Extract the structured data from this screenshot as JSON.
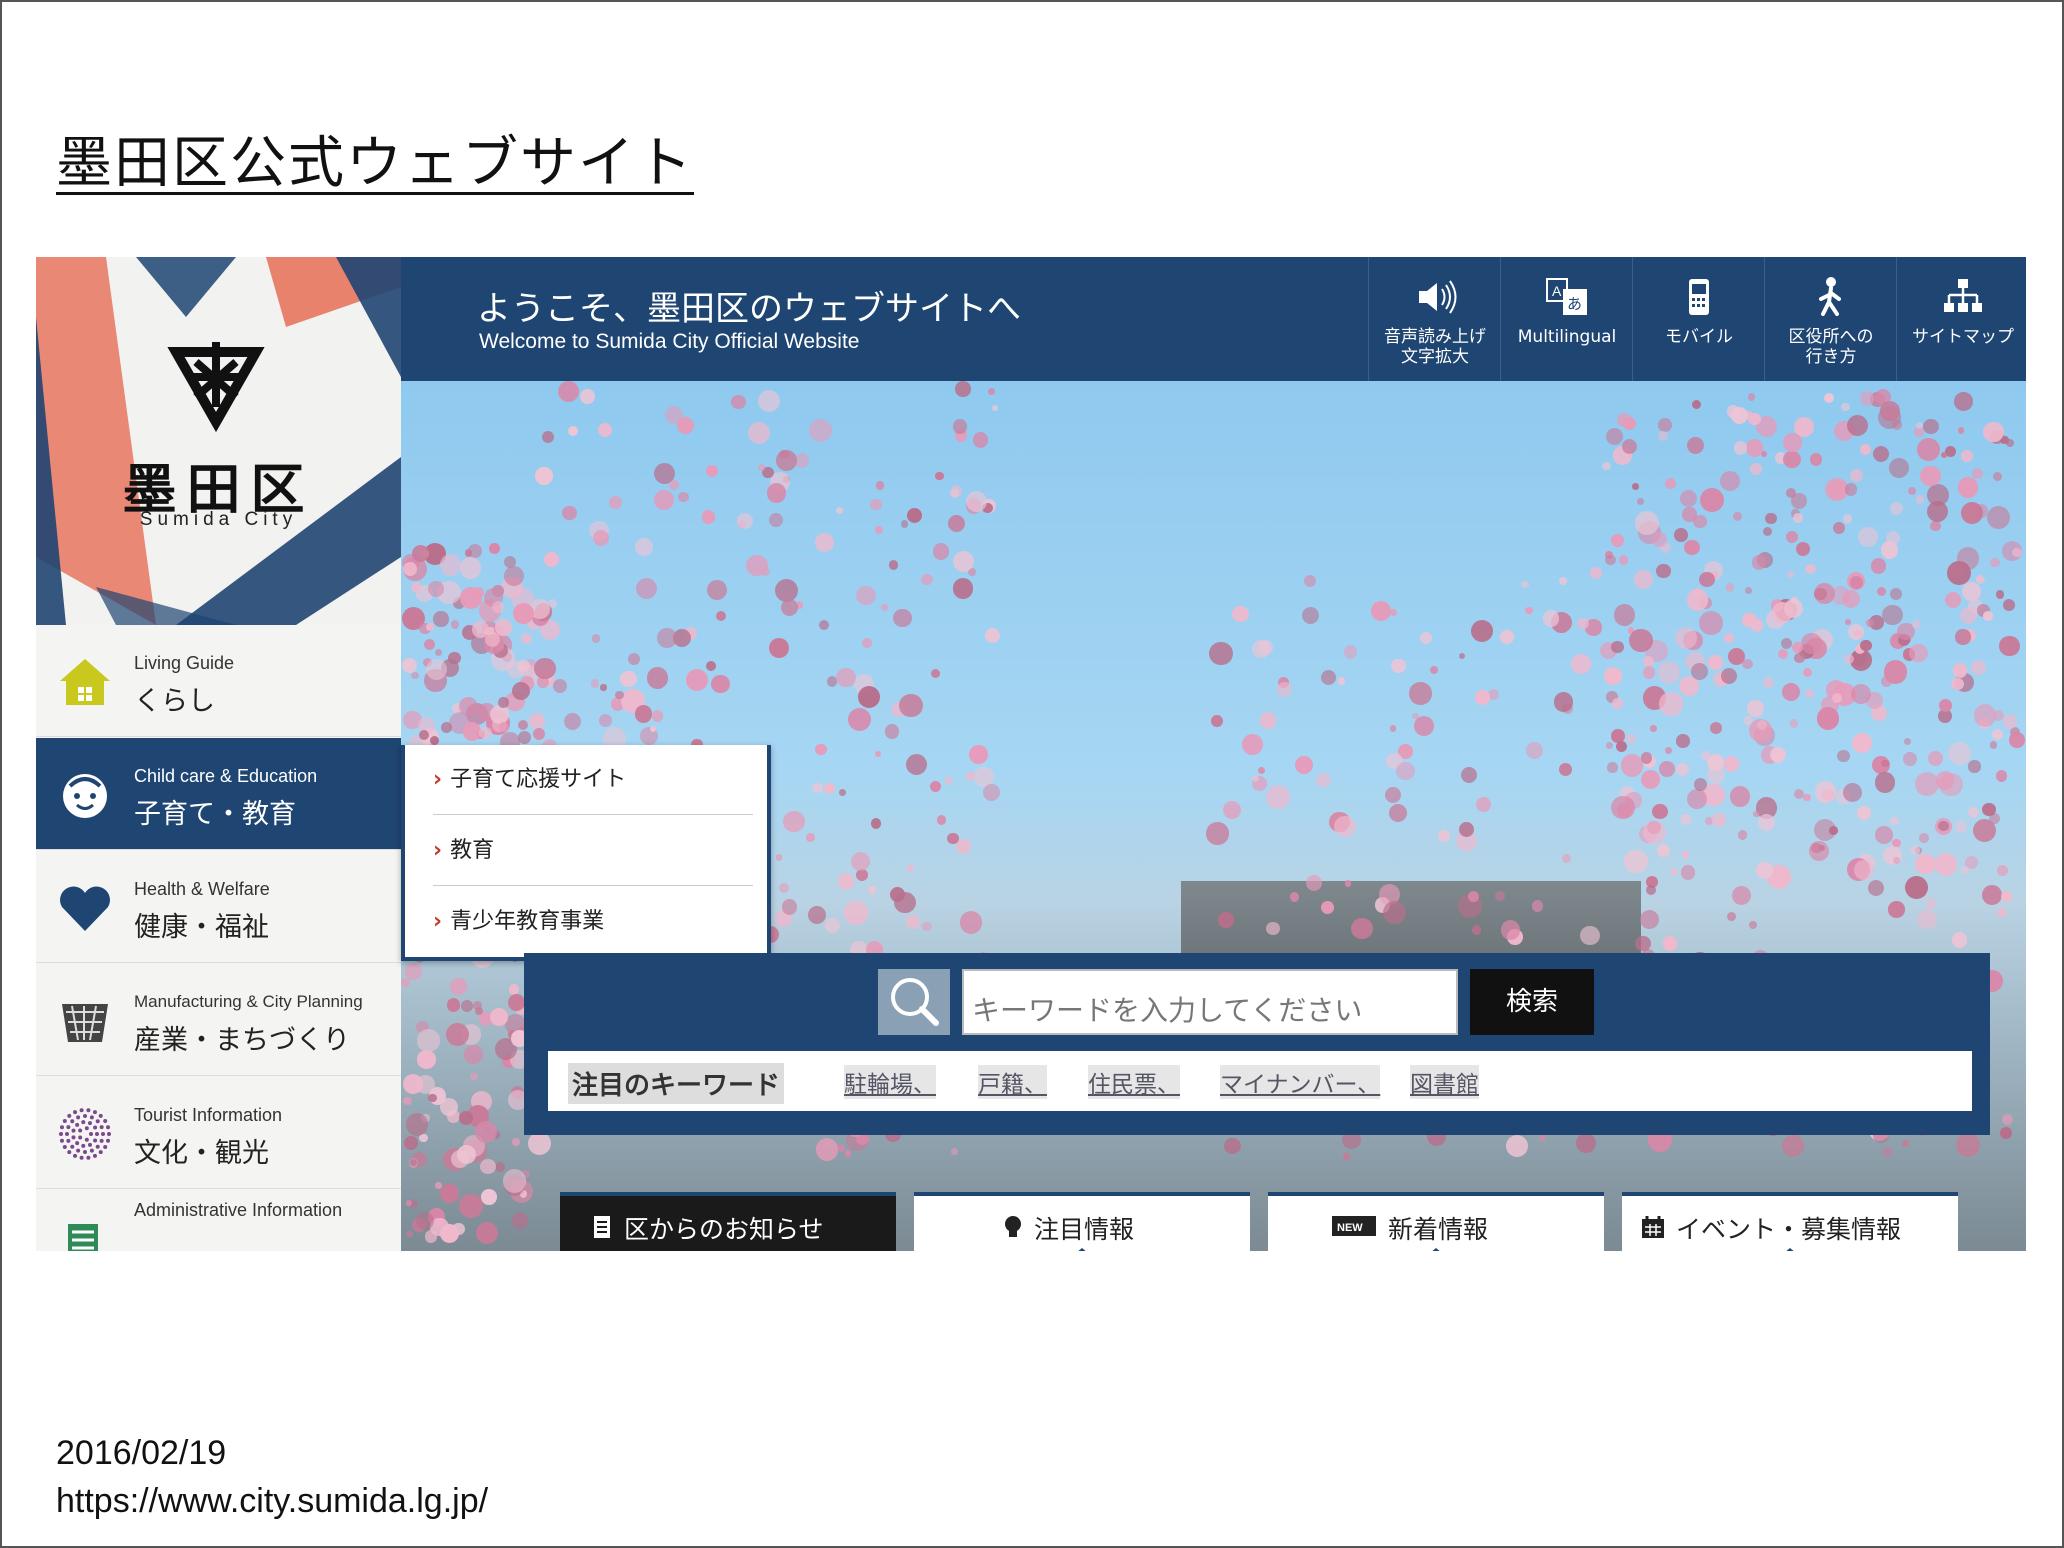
{
  "slide": {
    "title": "墨田区公式ウェブサイト",
    "date": "2016/02/19",
    "url": "https://www.city.sumida.lg.jp/"
  },
  "logo": {
    "name": "墨田区",
    "sub": "Sumida City"
  },
  "header": {
    "welcome_ja": "ようこそ、墨田区のウェブサイトへ",
    "welcome_en": "Welcome to Sumida City Official Website",
    "tools": [
      {
        "label": "音声読み上げ\n文字拡大",
        "icon": "speaker-icon"
      },
      {
        "label": "Multilingual",
        "icon": "multilingual-icon"
      },
      {
        "label": "モバイル",
        "icon": "mobile-icon"
      },
      {
        "label": "区役所への\n行き方",
        "icon": "walking-person-icon"
      },
      {
        "label": "サイトマップ",
        "icon": "sitemap-icon"
      }
    ]
  },
  "nav": [
    {
      "en": "Living Guide",
      "ja": "くらし",
      "icon": "house-icon",
      "color": "#c8c81e"
    },
    {
      "en": "Child care & Education",
      "ja": "子育て・教育",
      "icon": "child-face-icon",
      "active": true
    },
    {
      "en": "Health & Welfare",
      "ja": "健康・福祉",
      "icon": "heart-icon",
      "color": "#1f4572"
    },
    {
      "en": "Manufacturing & City Planning",
      "ja": "産業・まちづくり",
      "icon": "basket-icon"
    },
    {
      "en": "Tourist Information",
      "ja": "文化・観光",
      "icon": "dots-circle-icon",
      "color": "#7a4a8c"
    },
    {
      "en": "Administrative Information",
      "ja": "",
      "icon": "document-icon",
      "color": "#2e8b57"
    }
  ],
  "submenu": [
    "子育て応援サイト",
    "教育",
    "青少年教育事業"
  ],
  "search": {
    "placeholder": "キーワードを入力してください",
    "button": "検索",
    "keywords_label": "注目のキーワード",
    "keywords": [
      "駐輪場、",
      "戸籍、",
      "住民票、",
      "マイナンバー、",
      "図書館"
    ]
  },
  "tabs": [
    {
      "label": "区からのお知らせ",
      "icon": "document-icon"
    },
    {
      "label": "注目情報",
      "icon": "lightbulb-icon"
    },
    {
      "label": "新着情報",
      "icon": "new-badge-icon"
    },
    {
      "label": "イベント・募集情報",
      "icon": "calendar-icon"
    }
  ],
  "colors": {
    "navy": "#1f4572",
    "coral": "#e8765e",
    "sky": "#8fc9ef",
    "blossom": "#e79ab8"
  }
}
